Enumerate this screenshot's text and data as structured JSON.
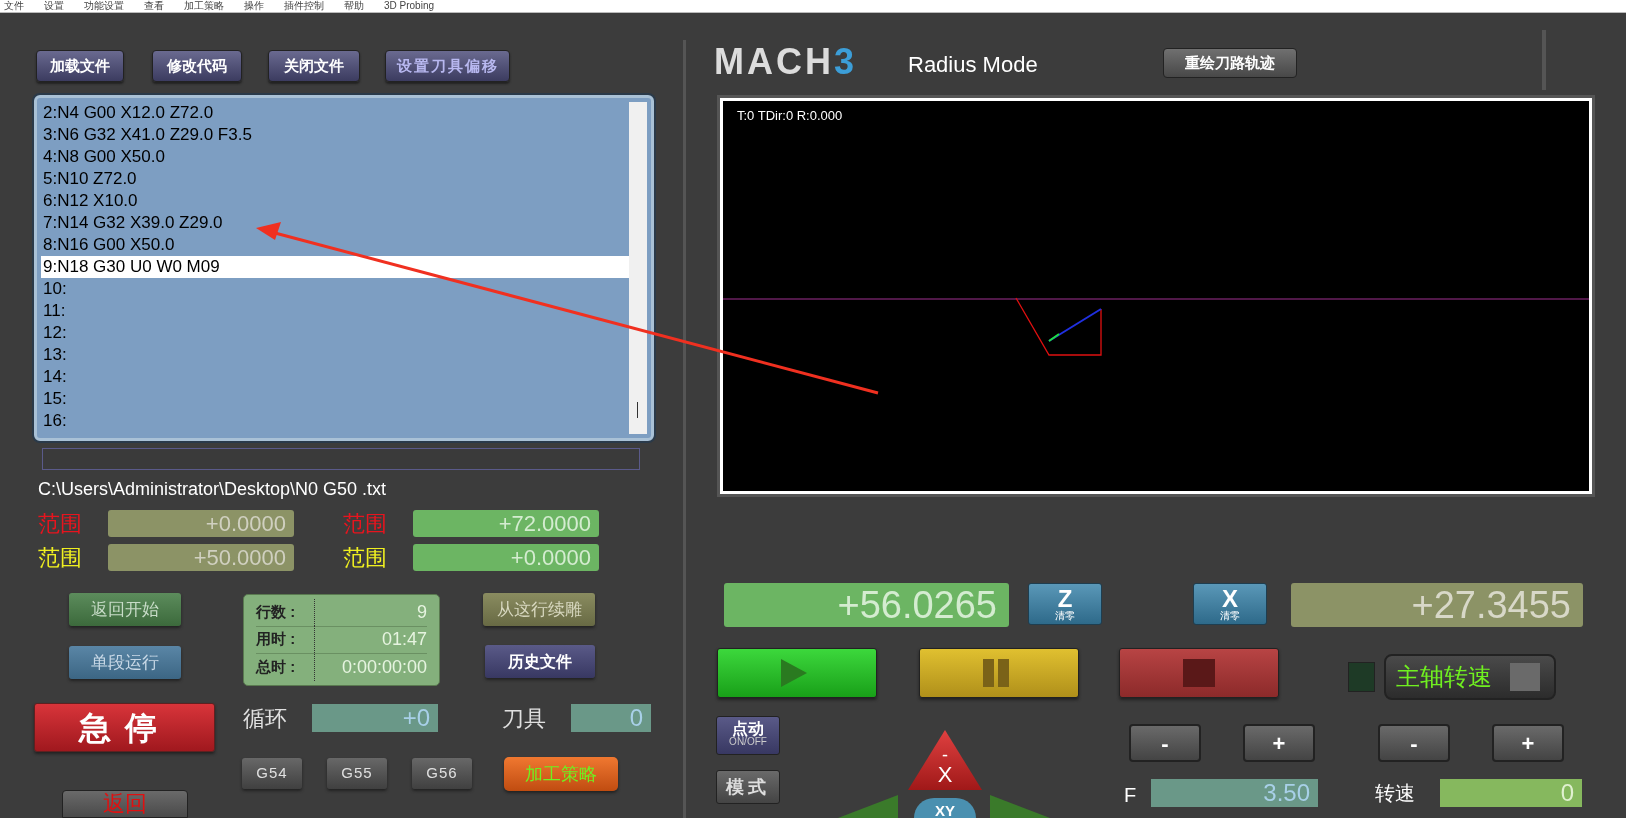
{
  "menu": [
    "文件",
    "设置",
    "功能设置",
    "查看",
    "加工策略",
    "操作",
    "插件控制",
    "帮助",
    "3D Probing"
  ],
  "toolbar_buttons": [
    "加载文件",
    "修改代码",
    "关闭文件",
    "设置刀具偏移"
  ],
  "gcode_lines": [
    {
      "text": "2:N4 G00 X12.0 Z72.0",
      "selected": false
    },
    {
      "text": "3:N6 G32 X41.0 Z29.0 F3.5",
      "selected": false
    },
    {
      "text": "4:N8 G00 X50.0",
      "selected": false
    },
    {
      "text": "5:N10 Z72.0",
      "selected": false
    },
    {
      "text": "6:N12 X10.0",
      "selected": false
    },
    {
      "text": "7:N14 G32 X39.0 Z29.0",
      "selected": false
    },
    {
      "text": "8:N16 G00 X50.0",
      "selected": false
    },
    {
      "text": "9:N18 G30 U0 W0 M09",
      "selected": true
    },
    {
      "text": "10:",
      "selected": false
    },
    {
      "text": "11:",
      "selected": false
    },
    {
      "text": "12:",
      "selected": false
    },
    {
      "text": "13:",
      "selected": false
    },
    {
      "text": "14:",
      "selected": false
    },
    {
      "text": "15:",
      "selected": false
    },
    {
      "text": "16:",
      "selected": false
    }
  ],
  "file_path": "C:\\Users\\Administrator\\Desktop\\N0 G50 .txt",
  "ranges": [
    {
      "label": "范围",
      "value": "+0.0000",
      "color": "#e8141e"
    },
    {
      "label": "范围",
      "value": "+72.0000",
      "color": "#e8141e"
    },
    {
      "label": "范围",
      "value": "+50.0000",
      "color": "#f0f020"
    },
    {
      "label": "范围",
      "value": "+0.0000",
      "color": "#f0f020"
    }
  ],
  "logo": "MACH3",
  "mode": "Radius Mode",
  "redraw_button": "重绘刀路轨迹",
  "toolpath": {
    "status": "T:0 TDir:0 R:0.000"
  },
  "dro": [
    {
      "axis": "Z",
      "caption": "清零",
      "value": "+56.0265"
    },
    {
      "axis": "X",
      "caption": "清零",
      "value": "+27.3455"
    }
  ],
  "cycle_buttons": [
    {
      "kind": "start"
    },
    {
      "kind": "pause"
    },
    {
      "kind": "stop"
    }
  ],
  "spindle": {
    "label": "主轴转速",
    "on": false
  },
  "left_buttons": {
    "rewind": "返回开始",
    "single_block": "单段运行",
    "estop": "急停",
    "back": "返回"
  },
  "stats": [
    {
      "label": "行数 :",
      "value": "9"
    },
    {
      "label": "用时 :",
      "value": "01:47"
    },
    {
      "label": "总时 :",
      "value": "0:00:00:00"
    }
  ],
  "progress": {
    "level": 0
  },
  "right_buttons": {
    "run_from_here": "从这行续雕",
    "history": "历史文件"
  },
  "cycle": {
    "label": "循环",
    "value": "+0"
  },
  "tool": {
    "label": "刀具",
    "value": "0"
  },
  "offset_buttons": [
    "G54",
    "G55",
    "G56"
  ],
  "strategy_button": "加工策略",
  "jog": {
    "toggle": "点动",
    "toggle_sub": "ON/OFF",
    "mode": "模式",
    "minus": "-",
    "axis": "X",
    "center": "XY"
  },
  "feed": {
    "label": "F",
    "value": "3.50",
    "minus": "-",
    "plus": "+"
  },
  "speed": {
    "label": "转速",
    "value": "0",
    "minus": "-",
    "plus": "+"
  }
}
